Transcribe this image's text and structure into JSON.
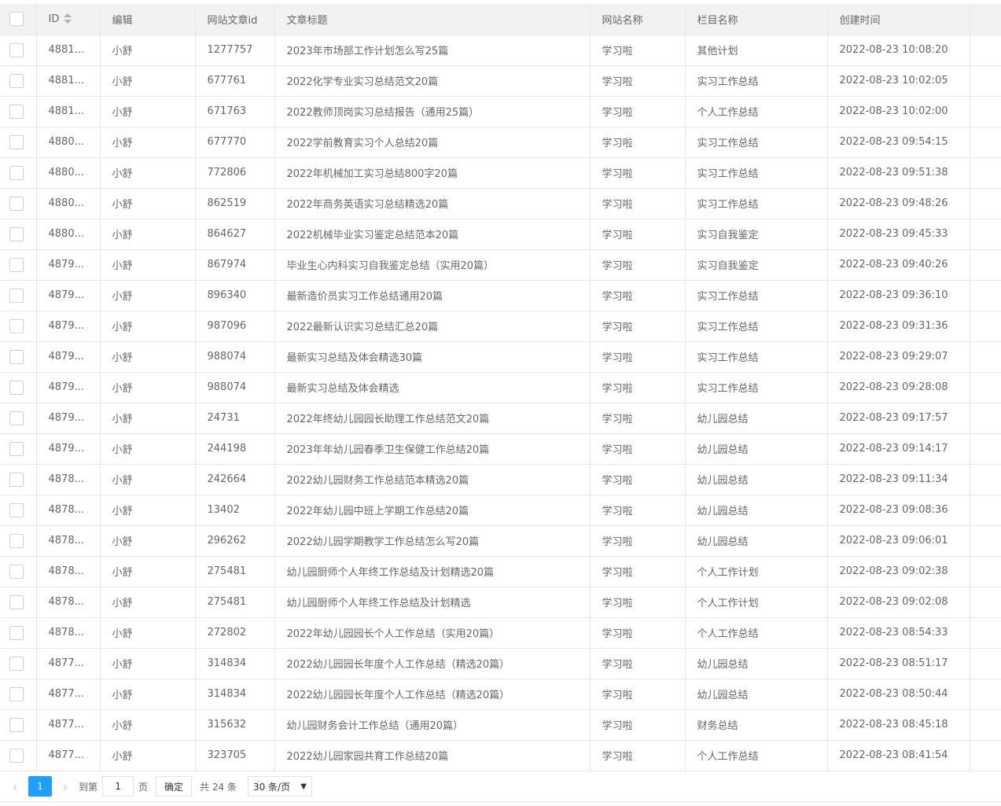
{
  "headers": {
    "id": "ID",
    "editor": "编辑",
    "site_article_id": "网站文章id",
    "title": "文章标题",
    "site_name": "网站名称",
    "column_name": "栏目名称",
    "created_at": "创建时间"
  },
  "rows": [
    {
      "id": "4881...",
      "editor": "小舒",
      "aid": "1277757",
      "title": "2023年市场部工作计划怎么写25篇",
      "site": "学习啦",
      "column": "其他计划",
      "time": "2022-08-23 10:08:20"
    },
    {
      "id": "4881...",
      "editor": "小舒",
      "aid": "677761",
      "title": "2022化学专业实习总结范文20篇",
      "site": "学习啦",
      "column": "实习工作总结",
      "time": "2022-08-23 10:02:05"
    },
    {
      "id": "4881...",
      "editor": "小舒",
      "aid": "671763",
      "title": "2022教师顶岗实习总结报告（通用25篇）",
      "site": "学习啦",
      "column": "个人工作总结",
      "time": "2022-08-23 10:02:00"
    },
    {
      "id": "4880...",
      "editor": "小舒",
      "aid": "677770",
      "title": "2022学前教育实习个人总结20篇",
      "site": "学习啦",
      "column": "实习工作总结",
      "time": "2022-08-23 09:54:15"
    },
    {
      "id": "4880...",
      "editor": "小舒",
      "aid": "772806",
      "title": "2022年机械加工实习总结800字20篇",
      "site": "学习啦",
      "column": "实习工作总结",
      "time": "2022-08-23 09:51:38"
    },
    {
      "id": "4880...",
      "editor": "小舒",
      "aid": "862519",
      "title": "2022年商务英语实习总结精选20篇",
      "site": "学习啦",
      "column": "实习工作总结",
      "time": "2022-08-23 09:48:26"
    },
    {
      "id": "4880...",
      "editor": "小舒",
      "aid": "864627",
      "title": "2022机械毕业实习鉴定总结范本20篇",
      "site": "学习啦",
      "column": "实习自我鉴定",
      "time": "2022-08-23 09:45:33"
    },
    {
      "id": "4879...",
      "editor": "小舒",
      "aid": "867974",
      "title": "毕业生心内科实习自我鉴定总结（实用20篇）",
      "site": "学习啦",
      "column": "实习自我鉴定",
      "time": "2022-08-23 09:40:26"
    },
    {
      "id": "4879...",
      "editor": "小舒",
      "aid": "896340",
      "title": "最新造价员实习工作总结通用20篇",
      "site": "学习啦",
      "column": "实习工作总结",
      "time": "2022-08-23 09:36:10"
    },
    {
      "id": "4879...",
      "editor": "小舒",
      "aid": "987096",
      "title": "2022最新认识实习总结汇总20篇",
      "site": "学习啦",
      "column": "实习工作总结",
      "time": "2022-08-23 09:31:36"
    },
    {
      "id": "4879...",
      "editor": "小舒",
      "aid": "988074",
      "title": "最新实习总结及体会精选30篇",
      "site": "学习啦",
      "column": "实习工作总结",
      "time": "2022-08-23 09:29:07"
    },
    {
      "id": "4879...",
      "editor": "小舒",
      "aid": "988074",
      "title": "最新实习总结及体会精选",
      "site": "学习啦",
      "column": "实习工作总结",
      "time": "2022-08-23 09:28:08"
    },
    {
      "id": "4879...",
      "editor": "小舒",
      "aid": "24731",
      "title": "2022年终幼儿园园长助理工作总结范文20篇",
      "site": "学习啦",
      "column": "幼儿园总结",
      "time": "2022-08-23 09:17:57"
    },
    {
      "id": "4879...",
      "editor": "小舒",
      "aid": "244198",
      "title": "2023年年幼儿园春季卫生保健工作总结20篇",
      "site": "学习啦",
      "column": "幼儿园总结",
      "time": "2022-08-23 09:14:17"
    },
    {
      "id": "4878...",
      "editor": "小舒",
      "aid": "242664",
      "title": "2022幼儿园财务工作总结范本精选20篇",
      "site": "学习啦",
      "column": "幼儿园总结",
      "time": "2022-08-23 09:11:34"
    },
    {
      "id": "4878...",
      "editor": "小舒",
      "aid": "13402",
      "title": "2022年幼儿园中班上学期工作总结20篇",
      "site": "学习啦",
      "column": "幼儿园总结",
      "time": "2022-08-23 09:08:36"
    },
    {
      "id": "4878...",
      "editor": "小舒",
      "aid": "296262",
      "title": "2022幼儿园学期教学工作总结怎么写20篇",
      "site": "学习啦",
      "column": "幼儿园总结",
      "time": "2022-08-23 09:06:01"
    },
    {
      "id": "4878...",
      "editor": "小舒",
      "aid": "275481",
      "title": "幼儿园厨师个人年终工作总结及计划精选20篇",
      "site": "学习啦",
      "column": "个人工作计划",
      "time": "2022-08-23 09:02:38"
    },
    {
      "id": "4878...",
      "editor": "小舒",
      "aid": "275481",
      "title": "幼儿园厨师个人年终工作总结及计划精选",
      "site": "学习啦",
      "column": "个人工作计划",
      "time": "2022-08-23 09:02:08"
    },
    {
      "id": "4878...",
      "editor": "小舒",
      "aid": "272802",
      "title": "2022年幼儿园园长个人工作总结（实用20篇）",
      "site": "学习啦",
      "column": "个人工作总结",
      "time": "2022-08-23 08:54:33"
    },
    {
      "id": "4877...",
      "editor": "小舒",
      "aid": "314834",
      "title": "2022幼儿园园长年度个人工作总结（精选20篇）",
      "site": "学习啦",
      "column": "幼儿园总结",
      "time": "2022-08-23 08:51:17"
    },
    {
      "id": "4877...",
      "editor": "小舒",
      "aid": "314834",
      "title": "2022幼儿园园长年度个人工作总结（精选20篇）",
      "site": "学习啦",
      "column": "幼儿园总结",
      "time": "2022-08-23 08:50:44"
    },
    {
      "id": "4877...",
      "editor": "小舒",
      "aid": "315632",
      "title": "幼儿园财务会计工作总结（通用20篇）",
      "site": "学习啦",
      "column": "财务总结",
      "time": "2022-08-23 08:45:18"
    },
    {
      "id": "4877...",
      "editor": "小舒",
      "aid": "323705",
      "title": "2022幼儿园家园共育工作总结20篇",
      "site": "学习啦",
      "column": "个人工作总结",
      "time": "2022-08-23 08:41:54"
    }
  ],
  "pager": {
    "current_page": "1",
    "goto_label": "到第",
    "goto_value": "1",
    "page_unit": "页",
    "confirm_label": "确定",
    "total_label": "共 24 条",
    "page_size_label": "30 条/页",
    "prev_icon": "chevron-left-icon",
    "next_icon": "chevron-right-icon",
    "accent_color": "#1E9FFF"
  }
}
